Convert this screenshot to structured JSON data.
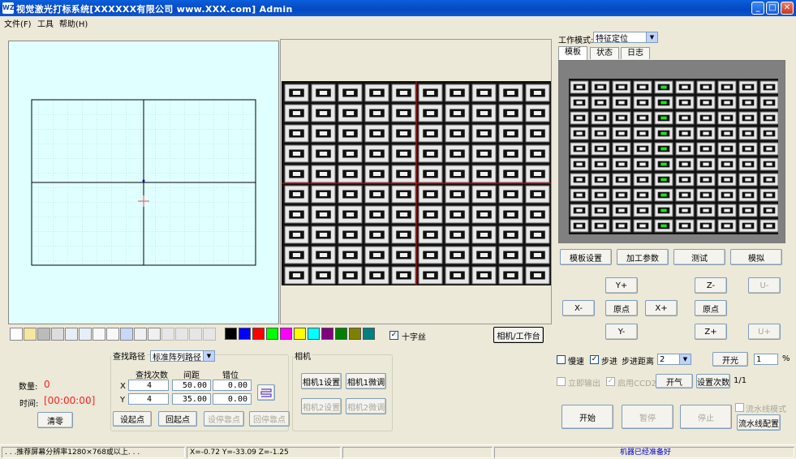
{
  "window": {
    "icon_label": "WZ",
    "title": "视觉激光打标系统[XXXXXX有限公司 www.XXX.com] Admin"
  },
  "menu": [
    "文件(F)",
    "工具",
    "帮助(H)"
  ],
  "toolbar": {
    "crosshair_label": "十字丝",
    "crosshair_checked": true,
    "camera_toggle_label": "相机/工作台",
    "colors": [
      "#000000",
      "#0000FF",
      "#FF0000",
      "#00FF00",
      "#FF00FF",
      "#FFFF00",
      "#00FFFF",
      "#800080",
      "#008000",
      "#808000",
      "#008080"
    ]
  },
  "counters": {
    "count_label": "数量:",
    "count_value": "0",
    "time_label": "时间:",
    "time_value": "[00:00:00]",
    "clear_label": "清零"
  },
  "search": {
    "group_label": "查找路径",
    "path_value": "标准阵列路径",
    "col_count": "查找次数",
    "col_spacing": "间距",
    "col_offset": "错位",
    "rows": [
      {
        "axis": "X",
        "count": "4",
        "spacing": "50.00",
        "offset": "0.00"
      },
      {
        "axis": "Y",
        "count": "4",
        "spacing": "35.00",
        "offset": "0.00"
      }
    ],
    "buttons": [
      "设起点",
      "回起点",
      "设停靠点",
      "回停靠点"
    ]
  },
  "camera": {
    "group_label": "相机",
    "cam1_setup": "相机1设置",
    "cam1_tune": "相机1微调",
    "cam2_setup": "相机2设置",
    "cam2_tune": "相机2微调"
  },
  "work": {
    "mode_label": "工作模式:",
    "mode_value": "特征定位",
    "tabs": [
      "模板",
      "状态",
      "日志"
    ],
    "buttons": [
      "模板设置",
      "加工参数",
      "测试",
      "模拟"
    ]
  },
  "jog": {
    "y_plus": "Y+",
    "y_minus": "Y-",
    "x_minus": "X-",
    "x_plus": "X+",
    "origin": "原点",
    "z_minus": "Z-",
    "z_plus": "Z+",
    "z_origin": "原点",
    "u_minus": "U-",
    "u_plus": "U+"
  },
  "motion": {
    "slow_label": "慢速",
    "slow_checked": false,
    "step_label": "步进",
    "step_checked": true,
    "step_dist_label": "步进距离",
    "step_dist_value": "2",
    "laser_on": "开光",
    "laser_value": "1",
    "percent": "%",
    "immediate_label": "立即输出",
    "ccd2_label": "启用CCD2",
    "gas_on": "开气",
    "set_count": "设置次数",
    "count_ratio": "1/1"
  },
  "run": {
    "start": "开始",
    "pause": "暂停",
    "stop": "停止",
    "pipeline_label": "流水线模式",
    "pipeline_config": "流水线配置"
  },
  "status": {
    "hint": ". . .推荐屏幕分辨率1280×768或以上. . .",
    "coords": "X=-0.72  Y=-33.09  Z=-1.25",
    "machine": "机器已经准备好"
  }
}
